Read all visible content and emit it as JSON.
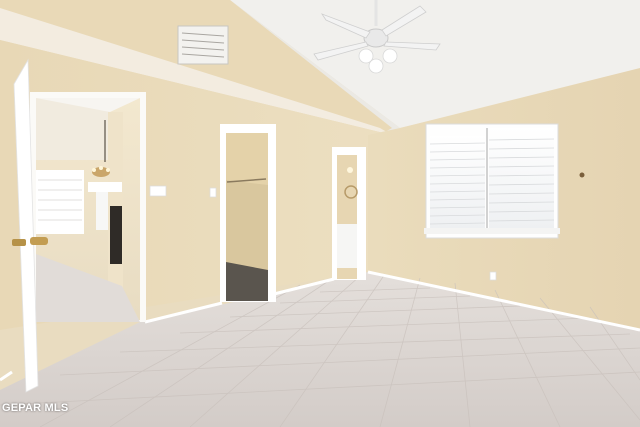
{
  "photo": {
    "subject": "empty-room-interior",
    "colors": {
      "wall": "#e8d9ba",
      "ceiling": "#f2f1ee",
      "floor": "#dcd6d2",
      "trim": "#ffffff"
    }
  },
  "watermark": {
    "text": "GEPAR MLS"
  }
}
